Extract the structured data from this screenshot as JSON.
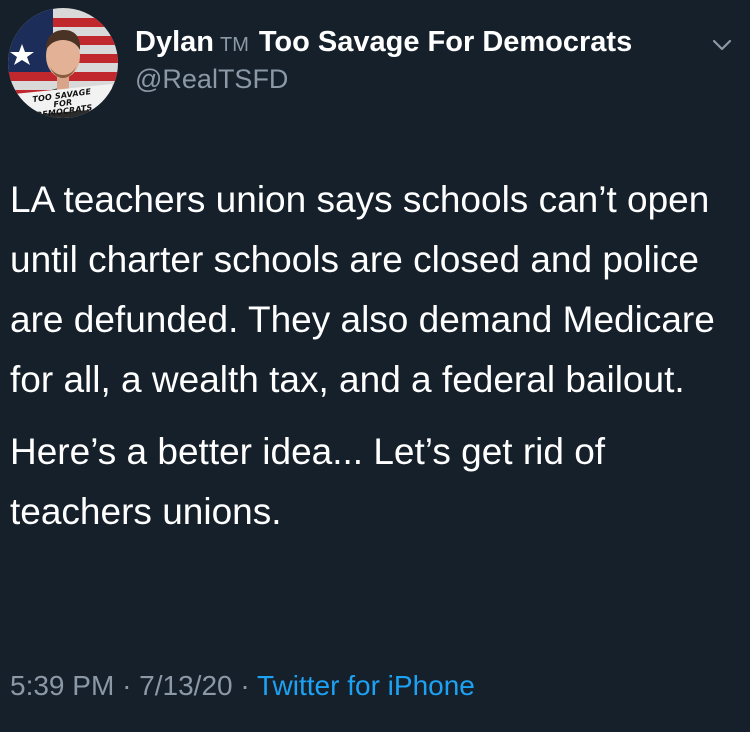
{
  "tweet": {
    "display_name": "Dylan",
    "tm": "TM",
    "display_name_rest": "Too Savage For Democrats",
    "handle": "@RealTSFD",
    "avatar_text": "TOO SAVAGE FOR DEMOCRATS",
    "paragraphs": [
      "LA teachers union says schools can’t open until charter schools are closed and police are defunded. They also demand Medicare for all, a wealth tax, and a federal bailout.",
      "Here’s a better idea... Let’s get rid of teachers unions."
    ],
    "time": "5:39 PM",
    "date": "7/13/20",
    "separator": "·",
    "source": "Twitter for iPhone"
  },
  "colors": {
    "background": "#15202b",
    "text": "#ffffff",
    "muted": "#8b98a5",
    "link": "#1da1f2"
  },
  "icons": {
    "more": "chevron-down-icon"
  }
}
